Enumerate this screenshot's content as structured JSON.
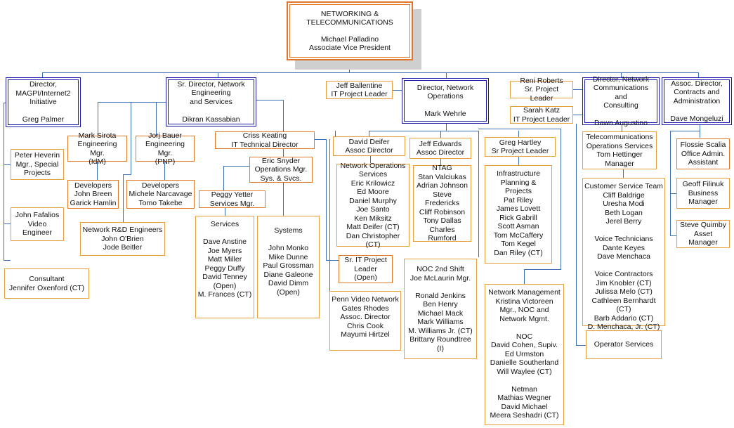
{
  "root": {
    "title": "NETWORKING &\nTELECOMMUNICATIONS",
    "name": "Michael Palladino",
    "role": "Associate Vice President"
  },
  "directors": {
    "magpi": "Director,\nMAGPI/Internet2\nInitiative\n\nGreg Palmer",
    "engineering": "Sr. Director, Network\nEngineering\nand Services\n\nDikran Kassabian",
    "operations": "Director, Network\nOperations\n\nMark Wehrle",
    "communications": "Director, Network\nCommunications and\nConsulting\n\nDawn Augustino",
    "contracts": "Assoc. Director,\nContracts and\nAdministration\n\nDave Mongeluzi"
  },
  "magpi_team": {
    "heverin": "Peter Heverin\nMgr., Special\nProjects",
    "fafalios": "John Fafalios\nVideo Engineer",
    "consultant": "Consultant\nJennifer Oxenford (CT)"
  },
  "engineering_team": {
    "sirota": "Mark Sirota\nEngineering Mgr.\n(IdM)",
    "bauer": "Jorj Bauer\nEngineering Mgr.\n(PNP)",
    "dev_idm": "Developers\nJohn Breen\nGarick Hamlin",
    "dev_pnp": "Developers\nMichele Narcavage\nTomo Takebe",
    "rnd": "Network R&D Engineers\nJohn O'Brien\nJode Beitler",
    "keating": "Criss Keating\nIT Technical Director",
    "snyder": "Eric Snyder\nOperations Mgr.\nSys. & Svcs.",
    "yetter": "Peggy Yetter\nServices Mgr.",
    "services": "Services\n\nDave Anstine\nJoe Myers\nMatt Miller\nPeggy Duffy\nDavid Tenney\n(Open)\nM. Frances (CT)",
    "systems": "Systems\n\nJohn Monko\nMike Dunne\nPaul Grossman\nDiane Galeone\nDavid Dimm\n(Open)",
    "sr_it_leader": "Sr. IT Project\nLeader\n(Open)",
    "penn_video": "Penn Video Network\nGates Rhodes\nAssoc. Director\nChris Cook\nMayumi Hirtzel"
  },
  "operations_team": {
    "ballentine": "Jeff Ballentine\nIT Project Leader",
    "deifer": "David Deifer\nAssoc Director",
    "edwards": "Jeff Edwards\nAssoc Director",
    "hartley": "Greg Hartley\nSr Project Leader",
    "nos": "Network Operations\nServices\nEric Krilowicz\nEd Moore\nDaniel Murphy\nJoe Santo\nKen Miksitz\nMatt Deifer (CT)\nDan Christopher (CT)",
    "ntag": "NTAG\nStan Valciukas\nAdrian Johnson\nSteve Fredericks\nCliff Robinson\nTony Dallas\nCharles Rumford",
    "infra": "Infrastructure\nPlanning & Projects\nPat Riley\nJames Lovett\nRick Gabrill\nScott Asman\nTom McCaffery\nTom Kegel\nDan Riley (CT)",
    "noc2": "NOC 2nd Shift\nJoe McLaurin Mgr.\n\nRonald Jenkins\nBen Henry\nMichael Mack\nMark Williams\nM. Williams Jr. (CT)\nBrittany Roundtree (I)",
    "netmgmt": "Network Management\nKristina Victoreen\nMgr., NOC and\nNetwork Mgmt.\n\nNOC\nDavid Cohen, Supiv.\nEd Urmston\nDanielle Southerland\nWill Waylee (CT)\n\nNetman\nMathias Wegner\nDavid Michael\nMeera Seshadri (CT)"
  },
  "communications_team": {
    "roberts": "Reni Roberts\nSr. Project Leader",
    "katz": "Sarah Katz\nIT Project Leader",
    "telecom": "Telecommunications\nOperations Services\nTom Hettinger\nManager",
    "customer": "Customer Service Team\nCliff Baldrige\nUresha Modi\nBeth Logan\nJerel Berry\n\nVoice Technicians\nDante Keyes\nDave Menchaca\n\nVoice Contractors\nJim Knobler (CT)\nJulissa Melo (CT)\nCathleen Bernhardt (CT)\nBarb Addario (CT)\nD. Menchaca, Jr. (CT)",
    "operator": "Operator Services"
  },
  "contracts_team": {
    "scalia": "Flossie Scalia\nOffice Admin.\nAssistant",
    "filinuk": "Geoff Filinuk\nBusiness\nManager",
    "quimby": "Steve Quimby\nAsset Manager"
  }
}
